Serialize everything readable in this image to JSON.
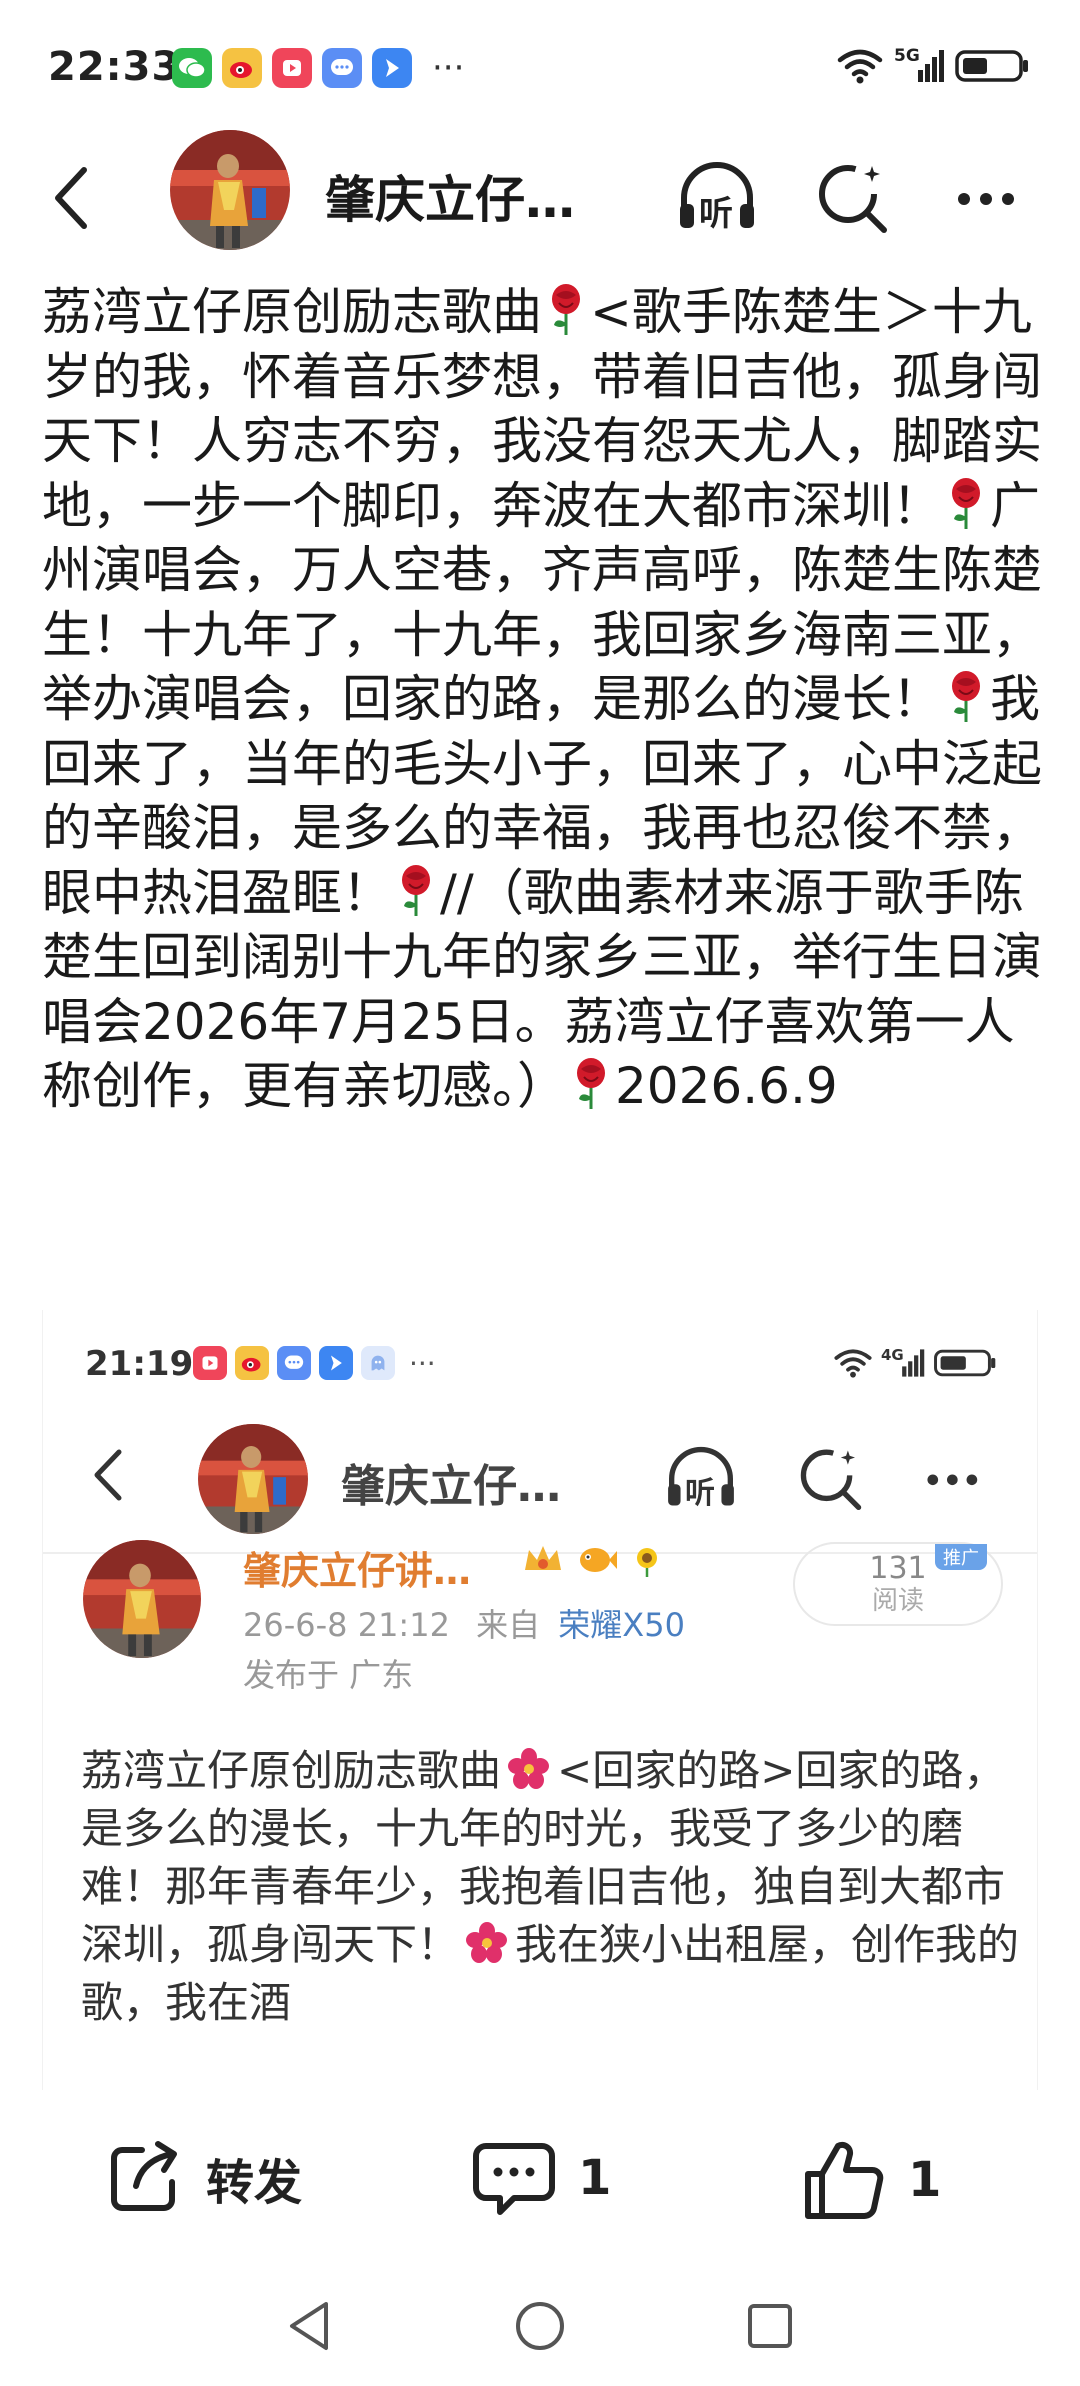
{
  "status_bar": {
    "time": "22:33",
    "more": "···",
    "network": "5G",
    "app_icons": [
      "wechat-icon",
      "weibo-icon",
      "video-icon",
      "message-icon",
      "send-icon"
    ]
  },
  "header": {
    "title": "肇庆立仔…",
    "listen_label": "听"
  },
  "post": {
    "text_parts": [
      "荔湾立仔原创励志歌曲",
      "<歌手陈楚生＞十九岁的我，怀着音乐梦想，带着旧吉他，孤身闯天下！人穷志不穷，我没有怨天尤人，脚踏实地，一步一个脚印，奔波在大都市深圳！",
      "广州演唱会，万人空巷，齐声高呼，陈楚生陈楚生！十九年了，十九年，我回家乡海南三亚，举办演唱会，回家的路，是那么的漫长！",
      "我回来了，当年的毛头小子，回来了，心中泛起的辛酸泪，是多么的幸福，我再也忍俊不禁，眼中热泪盈眶！",
      "//（歌曲素材来源于歌手陈楚生回到阔别十九年的家乡三亚，举行生日演唱会2026年7月25日。荔湾立仔喜欢第一人称创作，更有亲切感。）",
      "2026.6.9"
    ]
  },
  "embedded": {
    "time": "21:19",
    "more": "···",
    "network": "4G",
    "header_title": "肇庆立仔…",
    "listen_label": "听",
    "author": "肇庆立仔讲…",
    "post_time": "26-6-8 21:12",
    "from_label": "来自",
    "device": "荣耀X50",
    "location": "发布于 广东",
    "read_count": "131",
    "read_label": "阅读",
    "tag": "推广",
    "text_parts": [
      "荔湾立仔原创励志歌曲",
      "<回家的路>回家的路，是多么的漫长，十九年的时光，我受了多少的磨难！那年青春年少，我抱着旧吉他，独自到大都市深圳，孤身闯天下！",
      "我在狭小出租屋，创作我的歌，我在酒"
    ]
  },
  "actions": {
    "repost_label": "转发",
    "comment_count": "1",
    "like_count": "1"
  },
  "colors": {
    "accent_orange": "#e07d30",
    "device_blue": "#4a7fc1",
    "rose_red": "#d11a2a"
  }
}
